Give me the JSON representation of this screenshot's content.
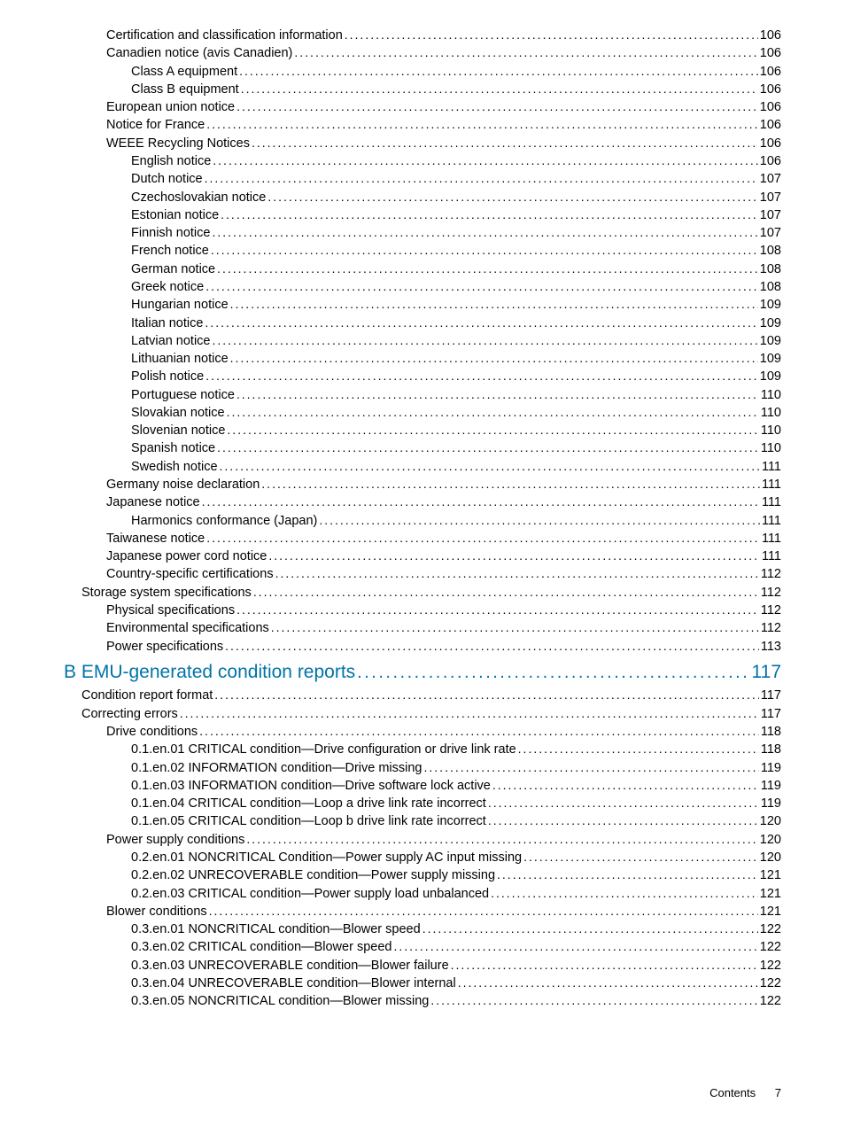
{
  "entries": [
    {
      "level": 2,
      "label": "Certification and classification information",
      "page": "106"
    },
    {
      "level": 2,
      "label": "Canadien notice (avis Canadien)",
      "page": "106"
    },
    {
      "level": 3,
      "label": "Class A equipment",
      "page": "106"
    },
    {
      "level": 3,
      "label": "Class B equipment",
      "page": "106"
    },
    {
      "level": 2,
      "label": "European union notice",
      "page": "106"
    },
    {
      "level": 2,
      "label": "Notice for France",
      "page": "106"
    },
    {
      "level": 2,
      "label": "WEEE Recycling Notices",
      "page": "106"
    },
    {
      "level": 3,
      "label": "English notice",
      "page": "106"
    },
    {
      "level": 3,
      "label": "Dutch notice",
      "page": "107"
    },
    {
      "level": 3,
      "label": "Czechoslovakian notice",
      "page": "107"
    },
    {
      "level": 3,
      "label": "Estonian notice",
      "page": "107"
    },
    {
      "level": 3,
      "label": "Finnish notice",
      "page": "107"
    },
    {
      "level": 3,
      "label": "French notice",
      "page": "108"
    },
    {
      "level": 3,
      "label": "German notice",
      "page": "108"
    },
    {
      "level": 3,
      "label": "Greek notice",
      "page": "108"
    },
    {
      "level": 3,
      "label": "Hungarian notice ",
      "page": "109"
    },
    {
      "level": 3,
      "label": "Italian notice",
      "page": "109"
    },
    {
      "level": 3,
      "label": "Latvian notice",
      "page": "109"
    },
    {
      "level": 3,
      "label": "Lithuanian notice",
      "page": "109"
    },
    {
      "level": 3,
      "label": "Polish notice",
      "page": "109"
    },
    {
      "level": 3,
      "label": "Portuguese notice",
      "page": "110"
    },
    {
      "level": 3,
      "label": "Slovakian notice",
      "page": "110"
    },
    {
      "level": 3,
      "label": "Slovenian notice",
      "page": "110"
    },
    {
      "level": 3,
      "label": "Spanish notice",
      "page": "110"
    },
    {
      "level": 3,
      "label": "Swedish notice",
      "page": "111"
    },
    {
      "level": 2,
      "label": "Germany noise declaration",
      "page": "111"
    },
    {
      "level": 2,
      "label": "Japanese notice",
      "page": "111"
    },
    {
      "level": 3,
      "label": "Harmonics conformance (Japan)",
      "page": "111"
    },
    {
      "level": 2,
      "label": "Taiwanese notice",
      "page": "111"
    },
    {
      "level": 2,
      "label": "Japanese power cord notice",
      "page": "111"
    },
    {
      "level": 2,
      "label": "Country-specific certifications",
      "page": "112"
    },
    {
      "level": 1,
      "label": "Storage system specifications",
      "page": "112"
    },
    {
      "level": 2,
      "label": "Physical specifications",
      "page": "112"
    },
    {
      "level": 2,
      "label": "Environmental specifications",
      "page": "112"
    },
    {
      "level": 2,
      "label": "Power specifications",
      "page": "113"
    },
    {
      "appendix": true,
      "label": "B EMU-generated condition reports",
      "page": "117"
    },
    {
      "level": 1,
      "label": "Condition report format",
      "page": "117"
    },
    {
      "level": 1,
      "label": "Correcting errors",
      "page": "117"
    },
    {
      "level": 2,
      "label": "Drive conditions",
      "page": "118"
    },
    {
      "level": 3,
      "label": "0.1.en.01 CRITICAL condition—Drive configuration or drive link rate",
      "page": "118"
    },
    {
      "level": 3,
      "label": "0.1.en.02 INFORMATION condition—Drive missing",
      "page": "119"
    },
    {
      "level": 3,
      "label": "0.1.en.03 INFORMATION condition—Drive software lock active",
      "page": "119"
    },
    {
      "level": 3,
      "label": "0.1.en.04 CRITICAL condition—Loop a drive link rate incorrect",
      "page": "119"
    },
    {
      "level": 3,
      "label": "0.1.en.05 CRITICAL condition—Loop b drive link rate incorrect",
      "page": "120"
    },
    {
      "level": 2,
      "label": "Power supply conditions",
      "page": "120"
    },
    {
      "level": 3,
      "label": "0.2.en.01 NONCRITICAL Condition—Power supply AC input missing",
      "page": "120"
    },
    {
      "level": 3,
      "label": "0.2.en.02 UNRECOVERABLE condition—Power supply missing ",
      "page": "121"
    },
    {
      "level": 3,
      "label": "0.2.en.03 CRITICAL condition—Power supply load unbalanced ",
      "page": "121"
    },
    {
      "level": 2,
      "label": "Blower conditions",
      "page": "121"
    },
    {
      "level": 3,
      "label": "0.3.en.01 NONCRITICAL condition—Blower speed",
      "page": "122"
    },
    {
      "level": 3,
      "label": "0.3.en.02 CRITICAL condition—Blower speed",
      "page": "122"
    },
    {
      "level": 3,
      "label": "0.3.en.03 UNRECOVERABLE condition—Blower failure ",
      "page": "122"
    },
    {
      "level": 3,
      "label": "0.3.en.04 UNRECOVERABLE condition—Blower internal",
      "page": "122"
    },
    {
      "level": 3,
      "label": "0.3.en.05 NONCRITICAL condition—Blower missing",
      "page": "122"
    }
  ],
  "footer": {
    "label": "Contents",
    "page": "7"
  }
}
